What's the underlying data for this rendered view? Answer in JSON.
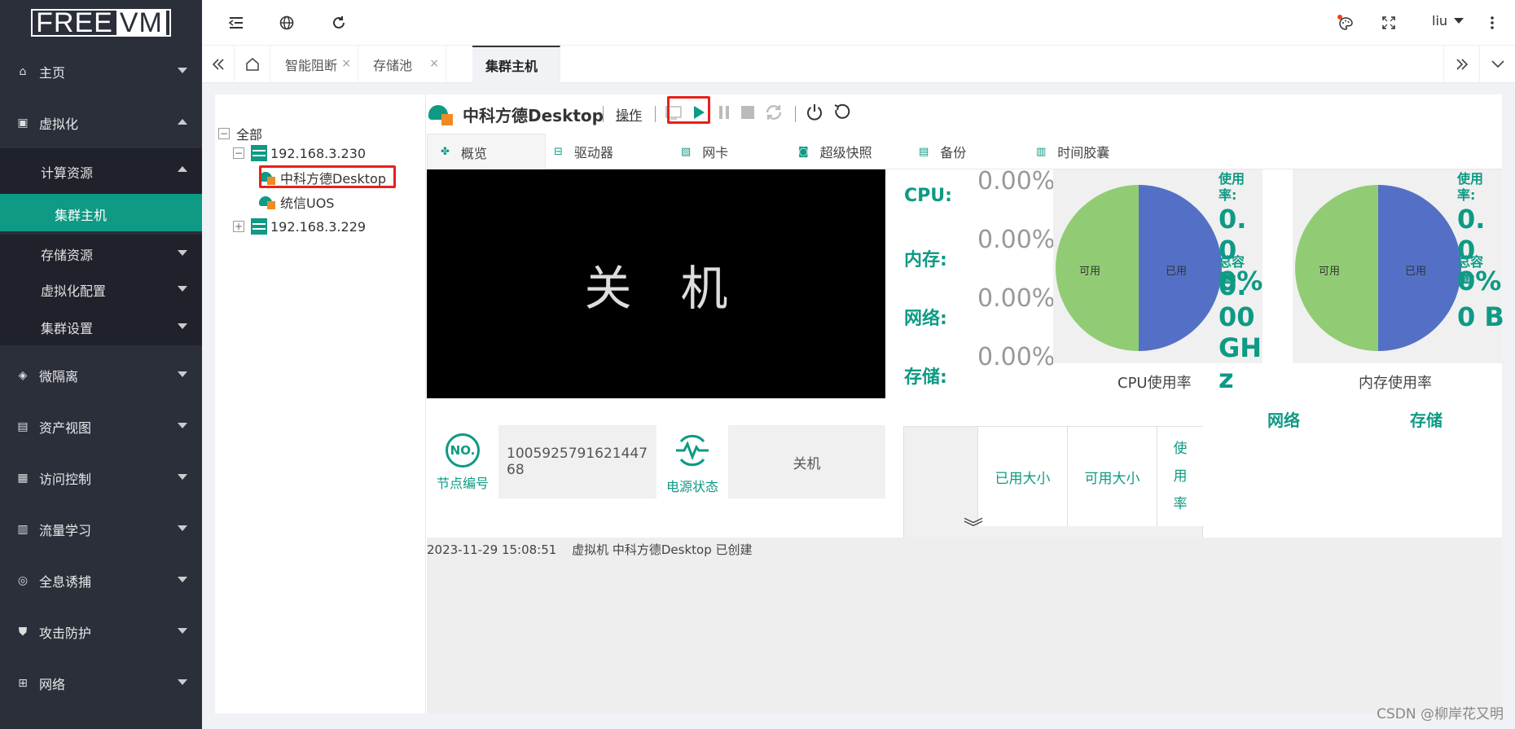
{
  "brand": {
    "logo_left": "FREE",
    "logo_right": "VM"
  },
  "sidebar": {
    "items": [
      {
        "label": "主页",
        "icon": "home-icon"
      },
      {
        "label": "虚拟化",
        "icon": "virtualization-icon"
      },
      {
        "label": "微隔离",
        "icon": "cube-icon"
      },
      {
        "label": "资产视图",
        "icon": "asset-icon"
      },
      {
        "label": "访问控制",
        "icon": "grid-icon"
      },
      {
        "label": "流量学习",
        "icon": "traffic-icon"
      },
      {
        "label": "全息诱捕",
        "icon": "trap-icon"
      },
      {
        "label": "攻击防护",
        "icon": "defense-icon"
      },
      {
        "label": "网络",
        "icon": "network-icon"
      }
    ],
    "sub": {
      "compute": "计算资源",
      "cluster_host": "集群主机",
      "storage": "存储资源",
      "virt_config": "虚拟化配置",
      "cluster_settings": "集群设置"
    }
  },
  "topbar": {
    "user": "liu"
  },
  "tabs": [
    {
      "label": "智能阻断",
      "close": "×"
    },
    {
      "label": "存储池",
      "close": "×"
    },
    {
      "label": "集群主机",
      "close": ""
    }
  ],
  "tree": {
    "root": "全部",
    "host1": "192.168.3.230",
    "vm1": "中科方德Desktop",
    "vm2": "统信UOS",
    "host2": "192.168.3.229",
    "collapse_sym": "−",
    "expand_sym": "+"
  },
  "vm": {
    "name": "中科方德Desktop",
    "operate": "操作",
    "tabs": [
      "概览",
      "驱动器",
      "网卡",
      "超级快照",
      "备份",
      "时间胶囊"
    ],
    "screen_text": "关机"
  },
  "stats": {
    "cpu_label": "CPU:",
    "cpu_val": "0.00%",
    "mem_label": "内存:",
    "mem_val": "0.00%",
    "net_label": "网络:",
    "net_val": "0.00%",
    "storage_label": "存储:",
    "storage_val": "0.00%"
  },
  "cpu_pie": {
    "used": "已用",
    "free": "可用",
    "usage_label": "使用率:",
    "usage_val": "0.00%",
    "total_label": "总容量:",
    "total_val": "0.00GHz",
    "caption": "CPU使用率",
    "used_color": "#5470c6",
    "free_color": "#91cc75",
    "used_fraction": 0.5
  },
  "mem_pie": {
    "used": "已用",
    "free": "可用",
    "usage_label": "使用率:",
    "usage_val": "0.00%",
    "total_label": "总容量:",
    "total_val": "0 B",
    "caption": "内存使用率",
    "used_fraction": 0.5
  },
  "sections": {
    "network": "网络",
    "storage": "存储"
  },
  "info": {
    "node_icon": "NO.",
    "node_label": "节点编号",
    "node_value": "100592579162144768",
    "power_label": "电源状态",
    "power_value": "关机"
  },
  "storage_table": {
    "headers": [
      "已用大小",
      "可用大小",
      "使用率"
    ],
    "expand": "︾"
  },
  "log": {
    "time": "2023-11-29 15:08:51",
    "msg": "虚拟机 中科方德Desktop 已创建"
  },
  "watermark": "CSDN @柳岸花又明"
}
